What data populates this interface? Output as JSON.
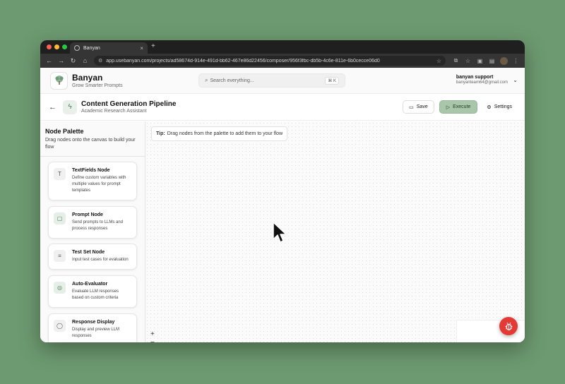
{
  "browser": {
    "tab_title": "Banyan",
    "new_tab": "+",
    "tab_close": "×",
    "url": "app.usebanyan.com/projects/ad58674d-914e-491d-bb62-467e86d22456/composer/956f3fbc-db5b-4c6e-811e-6b0cecce06d0"
  },
  "header": {
    "brand_name": "Banyan",
    "tagline": "Grow Smarter Prompts",
    "search_placeholder": "Search everything...",
    "search_shortcut": "⌘ K",
    "user_name": "banyan support",
    "user_email": "banyanteam64@gmail.com"
  },
  "flow": {
    "title": "Content Generation Pipeline",
    "subtitle": "Academic Research Assistant",
    "save_label": "Save",
    "execute_label": "Execute",
    "settings_label": "Settings"
  },
  "palette": {
    "title": "Node Palette",
    "description": "Drag nodes onto the canvas to build your flow",
    "nodes": [
      {
        "icon": "text-icon",
        "title": "TextFields Node",
        "description": "Define custom variables with multiple values for prompt templates"
      },
      {
        "icon": "message-icon",
        "title": "Prompt Node",
        "description": "Send prompts to LLMs and process responses"
      },
      {
        "icon": "database-icon",
        "title": "Test Set Node",
        "description": "Input test cases for evaluation"
      },
      {
        "icon": "target-icon",
        "title": "Auto-Evaluator",
        "description": "Evaluate LLM responses based on custom criteria"
      },
      {
        "icon": "chat-bubble-icon",
        "title": "Response Display",
        "description": "Display and preview LLM responses"
      }
    ]
  },
  "canvas": {
    "tip_label": "Tip:",
    "tip_text": "Drag nodes from the palette to add them to your flow",
    "zoom_in": "+",
    "zoom_out": "−"
  },
  "colors": {
    "accent": "#a9c6ab",
    "fab": "#e53935",
    "desktop": "#6d9a70"
  }
}
